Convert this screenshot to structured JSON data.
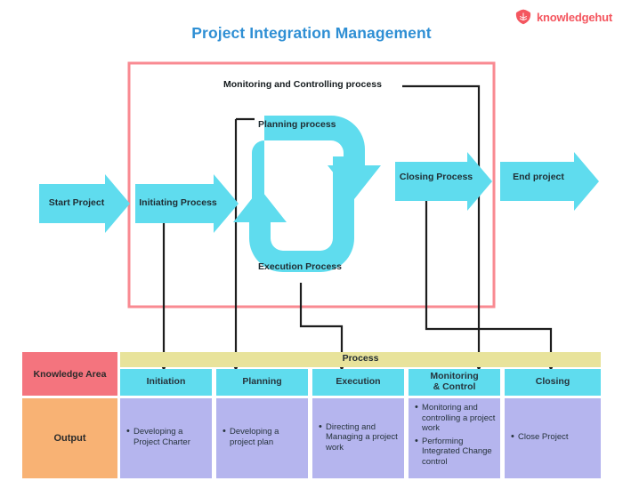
{
  "header": {
    "title": "Project Integration Management",
    "title_color": "#2F8FD4",
    "brand_name": "knowledgehut",
    "brand_color": "#F4565F",
    "brand_icon": "knowledgehut-shield-logo"
  },
  "diagram": {
    "boundary_label": "project-boundary-box",
    "boundary_color": "#F98A92",
    "arrow_color": "#5FDCEE",
    "connector_color": "#1d1d1d",
    "flow_arrows": [
      {
        "id": "start-project",
        "label": "Start Project"
      },
      {
        "id": "initiating-process",
        "label": "Initiating Process"
      },
      {
        "id": "planning-process",
        "label": "Planning process"
      },
      {
        "id": "execution-process",
        "label": "Execution Process"
      },
      {
        "id": "closing-process",
        "label": "Closing Process"
      },
      {
        "id": "end-project",
        "label": "End project"
      }
    ],
    "monitoring_label": "Monitoring and Controlling process"
  },
  "matrix": {
    "row_headers": [
      {
        "id": "knowledge-area",
        "label": "Knowledge Area",
        "color": "#F4747E"
      },
      {
        "id": "output",
        "label": "Output",
        "color": "#F8B274"
      }
    ],
    "band_label": "Process",
    "band_color": "#E8E39B",
    "phase_color": "#5FDCEE",
    "output_color": "#B5B5EE",
    "columns": [
      {
        "id": "initiation",
        "phase": "Initiation",
        "phase_lines": [
          "Initiation"
        ],
        "outputs": [
          "Developing a Project Charter"
        ]
      },
      {
        "id": "planning",
        "phase": "Planning",
        "phase_lines": [
          "Planning"
        ],
        "outputs": [
          "Developing a project plan"
        ]
      },
      {
        "id": "execution",
        "phase": "Execution",
        "phase_lines": [
          "Execution"
        ],
        "outputs": [
          "Directing and Managing a project work"
        ]
      },
      {
        "id": "monitoring-control",
        "phase": "Monitoring & Control",
        "phase_lines": [
          "Monitoring",
          "& Control"
        ],
        "outputs": [
          "Monitoring and controlling a project work",
          "Performing Integrated Change control"
        ]
      },
      {
        "id": "closing",
        "phase": "Closing",
        "phase_lines": [
          "Closing"
        ],
        "outputs": [
          "Close Project"
        ]
      }
    ]
  }
}
